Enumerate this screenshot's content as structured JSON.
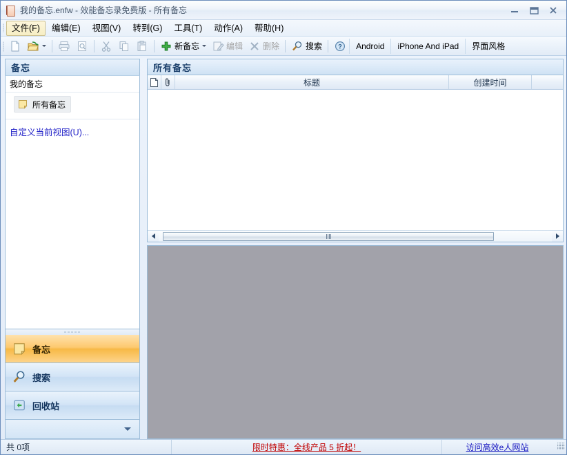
{
  "window": {
    "title": "我的备忘.enfw - 效能备忘录免费版 - 所有备忘",
    "app_icon": "memo-pad-icon",
    "minimize_label": "−",
    "maximize_label": "□",
    "close_label": "✕"
  },
  "menubar": {
    "items": [
      {
        "label": "文件(F)",
        "active": true
      },
      {
        "label": "编辑(E)",
        "active": false
      },
      {
        "label": "视图(V)",
        "active": false
      },
      {
        "label": "转到(G)",
        "active": false
      },
      {
        "label": "工具(T)",
        "active": false
      },
      {
        "label": "动作(A)",
        "active": false
      },
      {
        "label": "帮助(H)",
        "active": false
      }
    ]
  },
  "toolbar": {
    "new_file_icon": "new-document-icon",
    "open_icon": "open-folder-icon",
    "print_icon": "print-icon",
    "print_preview_icon": "print-preview-icon",
    "cut_icon": "cut-icon",
    "copy_icon": "copy-icon",
    "paste_icon": "paste-icon",
    "new_memo": "新备忘",
    "edit": "编辑",
    "delete": "删除",
    "search": "搜索",
    "help_icon": "help-question-icon",
    "android": "Android",
    "iphone_ipad": "iPhone And iPad",
    "skin": "界面风格"
  },
  "sidebar": {
    "header": "备忘",
    "group": "我的备忘",
    "node": "所有备忘",
    "customize_link": "自定义当前视图(U)...",
    "nav": [
      {
        "label": "备忘",
        "icon": "memo-note-icon",
        "selected": true
      },
      {
        "label": "搜索",
        "icon": "magnifier-icon",
        "selected": false
      },
      {
        "label": "回收站",
        "icon": "recycle-bin-icon",
        "selected": false
      }
    ]
  },
  "list": {
    "header": "所有备忘",
    "columns": [
      {
        "label": "",
        "icon": "document-icon",
        "key": "doc"
      },
      {
        "label": "",
        "icon": "paperclip-icon",
        "key": "clip"
      },
      {
        "label": "标题",
        "key": "title"
      },
      {
        "label": "创建时间",
        "key": "created"
      },
      {
        "label": "",
        "key": "extra"
      }
    ],
    "rows": []
  },
  "statusbar": {
    "count": "共 0项",
    "promo": "限时特惠：全线产品 5 折起！",
    "site": "访问高效e人网站",
    "promo_color": "#c00000",
    "site_color": "#1414c0"
  }
}
